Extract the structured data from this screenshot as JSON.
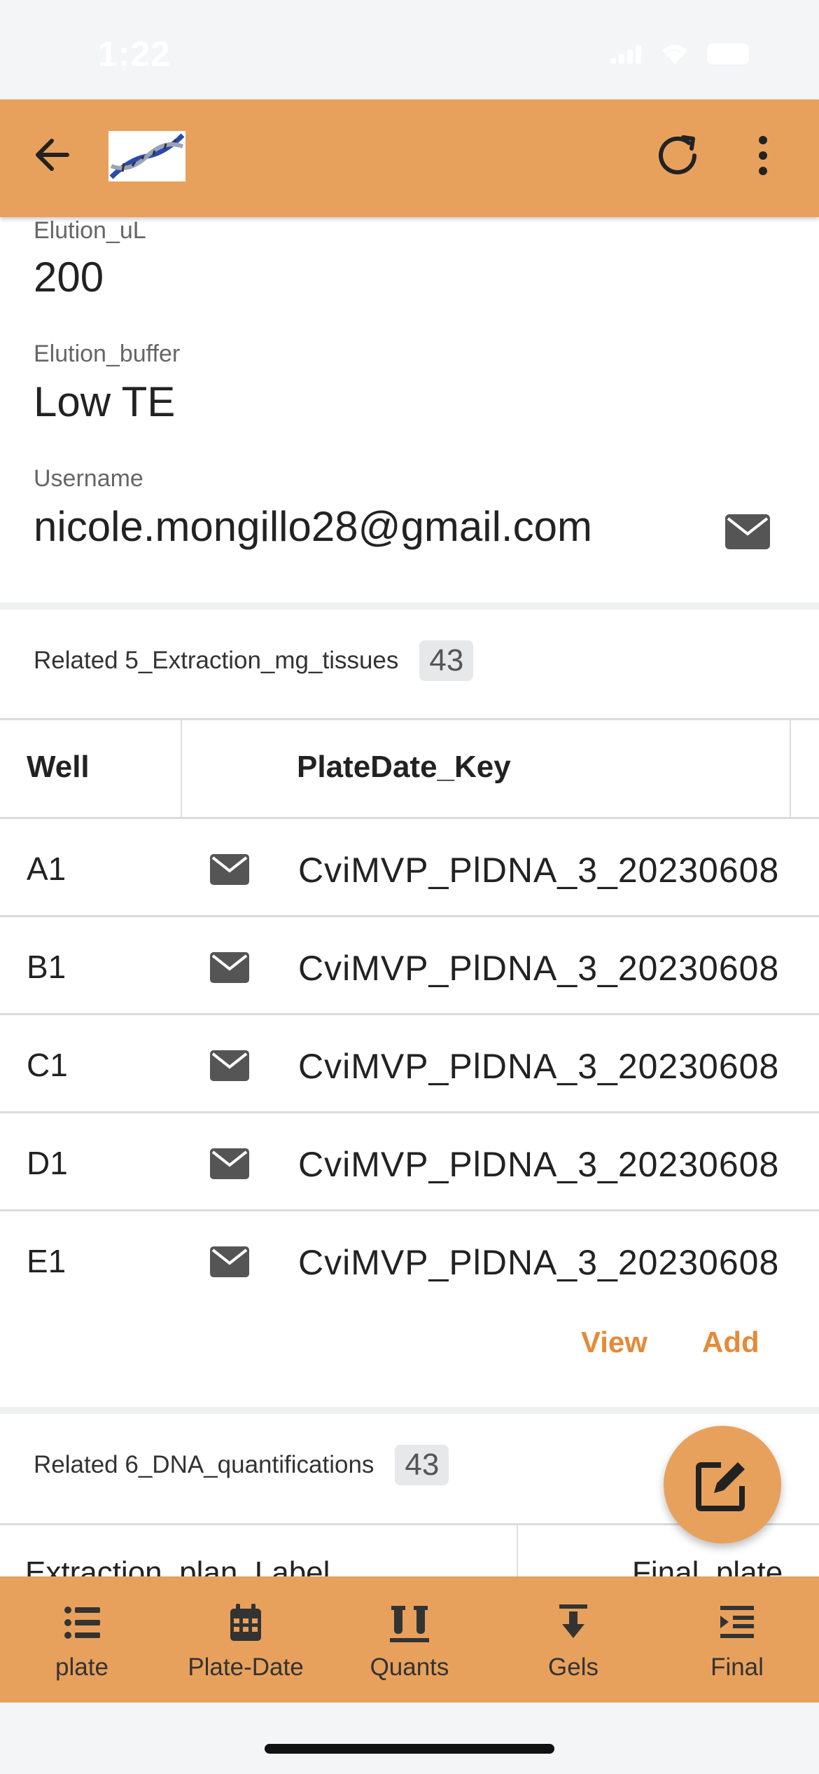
{
  "status": {
    "time": "1:22"
  },
  "fields": {
    "elution_ul": {
      "label": "Elution_uL",
      "value": "200"
    },
    "elution_buffer": {
      "label": "Elution_buffer",
      "value": "Low TE"
    },
    "username": {
      "label": "Username",
      "value": "nicole.mongillo28@gmail.com"
    }
  },
  "related_extraction": {
    "title": "Related 5_Extraction_mg_tissues",
    "count": "43",
    "columns": [
      "Well",
      "PlateDate_Key"
    ],
    "rows": [
      {
        "well": "A1",
        "key": "CviMVP_PlDNA_3_20230608"
      },
      {
        "well": "B1",
        "key": "CviMVP_PlDNA_3_20230608"
      },
      {
        "well": "C1",
        "key": "CviMVP_PlDNA_3_20230608"
      },
      {
        "well": "D1",
        "key": "CviMVP_PlDNA_3_20230608"
      },
      {
        "well": "E1",
        "key": "CviMVP_PlDNA_3_20230608"
      }
    ],
    "view_label": "View",
    "add_label": "Add"
  },
  "related_quant": {
    "title": "Related 6_DNA_quantifications",
    "count": "43",
    "columns": [
      "Extraction_plan_Label",
      "Final_plate"
    ]
  },
  "bottom_nav": [
    {
      "label": "plate",
      "icon": "list-icon"
    },
    {
      "label": "Plate-Date",
      "icon": "calendar-icon"
    },
    {
      "label": "Quants",
      "icon": "test-tubes-icon"
    },
    {
      "label": "Gels",
      "icon": "download-icon"
    },
    {
      "label": "Final",
      "icon": "indent-icon"
    }
  ],
  "colors": {
    "accent": "#e8a15c",
    "link": "#e58a3a"
  }
}
